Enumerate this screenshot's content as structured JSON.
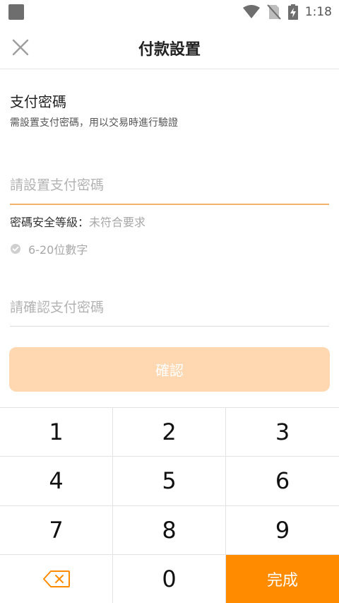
{
  "status_bar": {
    "time": "1:18",
    "icons": [
      "app-icon",
      "wifi-icon",
      "no-sim-icon",
      "battery-charging-icon"
    ]
  },
  "header": {
    "title": "付款設置",
    "close_icon": "close-icon"
  },
  "section": {
    "title": "支付密碼",
    "description": "需設置支付密碼，用以交易時進行驗證"
  },
  "password_input": {
    "value": "",
    "placeholder": "請設置支付密碼"
  },
  "strength": {
    "label": "密碼安全等級：",
    "value": "未符合要求"
  },
  "rule": {
    "text": "6-20位數字",
    "icon": "check-circle-icon"
  },
  "confirm_input": {
    "value": "",
    "placeholder": "請確認支付密碼"
  },
  "confirm_button": {
    "label": "確認"
  },
  "keypad": {
    "keys": [
      "1",
      "2",
      "3",
      "4",
      "5",
      "6",
      "7",
      "8",
      "9"
    ],
    "backspace_icon": "backspace-icon",
    "zero": "0",
    "done_label": "完成"
  },
  "colors": {
    "accent": "#ff8c00",
    "button_disabled": "#ffd7b0",
    "input_focus_line": "#f4b36a"
  }
}
